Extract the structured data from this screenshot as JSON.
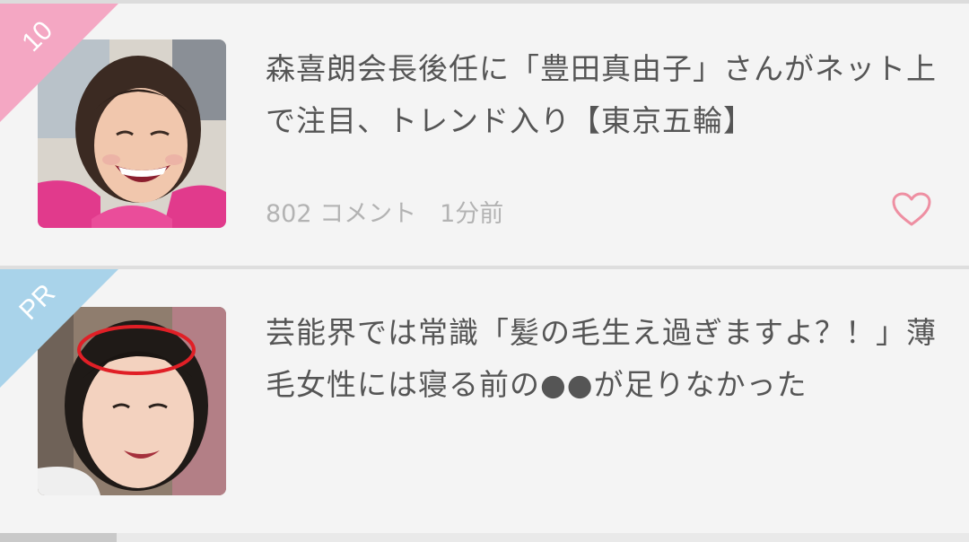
{
  "articles": [
    {
      "rank_label": "10",
      "headline": "森喜朗会長後任に「豊田真由子」さんがネット上で注目、トレンド入り【東京五輪】",
      "comments": "802 コメント",
      "time": "1分前",
      "ribbon_color": "#f4a7c3",
      "favorite_icon": "heart-outline-icon",
      "favorite_color": "#ee8fa2"
    },
    {
      "rank_label": "PR",
      "headline": "芸能界では常識「髪の毛生え過ぎますよ？！」薄毛女性には寝る前の●●が足りなかった",
      "ribbon_color": "#a9d3ea"
    }
  ]
}
